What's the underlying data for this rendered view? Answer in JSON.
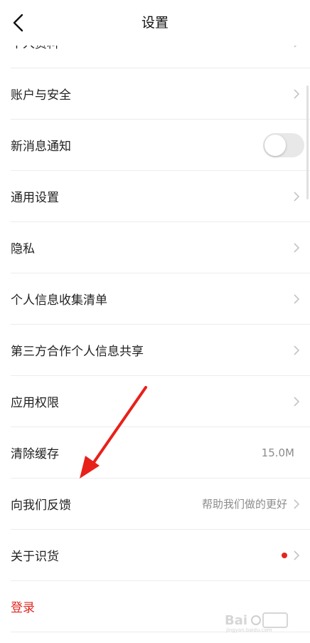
{
  "header": {
    "title": "设置"
  },
  "items": [
    {
      "label": "个人资料"
    },
    {
      "label": "账户与安全"
    },
    {
      "label": "新消息通知",
      "toggle": false
    },
    {
      "label": "通用设置"
    },
    {
      "label": "隐私"
    },
    {
      "label": "个人信息收集清单"
    },
    {
      "label": "第三方合作个人信息共享"
    },
    {
      "label": "应用权限"
    },
    {
      "label": "清除缓存",
      "value": "15.0M"
    },
    {
      "label": "向我们反馈",
      "value": "帮助我们做的更好"
    },
    {
      "label": "关于识货",
      "badge": "red-dot"
    },
    {
      "label": "登录"
    }
  ],
  "colors": {
    "accent": "#e0271f",
    "annotation_arrow": "#e8201a"
  },
  "icons": {
    "back": "back-arrow-icon",
    "chevron": "chevron-right-icon"
  }
}
